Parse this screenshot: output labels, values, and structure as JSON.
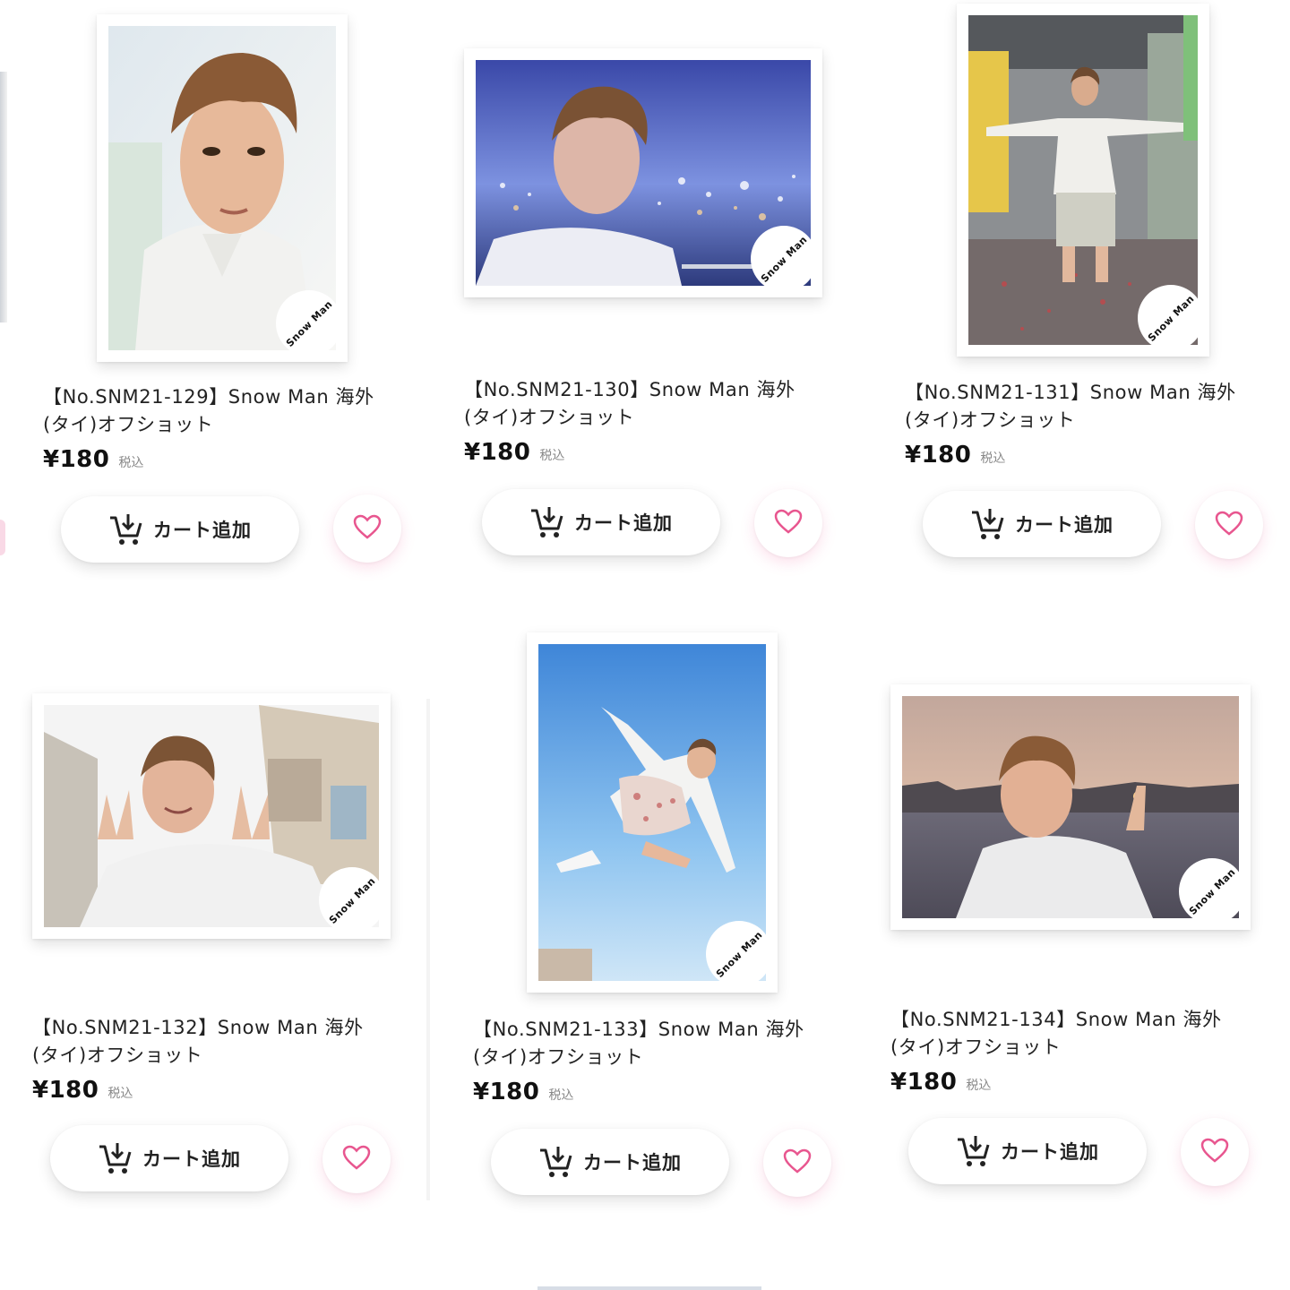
{
  "products": [
    {
      "title": "【No.SNM21-129】Snow Man 海外(タイ)オフショット",
      "price": "¥180",
      "tax_label": "税込",
      "cart_label": "カート追加",
      "photo_stamp": "Snow Man"
    },
    {
      "title": "【No.SNM21-130】Snow Man 海外(タイ)オフショット",
      "price": "¥180",
      "tax_label": "税込",
      "cart_label": "カート追加",
      "photo_stamp": "Snow Man"
    },
    {
      "title": "【No.SNM21-131】Snow Man 海外(タイ)オフショット",
      "price": "¥180",
      "tax_label": "税込",
      "cart_label": "カート追加",
      "photo_stamp": "Snow Man"
    },
    {
      "title": "【No.SNM21-132】Snow Man 海外(タイ)オフショット",
      "price": "¥180",
      "tax_label": "税込",
      "cart_label": "カート追加",
      "photo_stamp": "Snow Man"
    },
    {
      "title": "【No.SNM21-133】Snow Man 海外(タイ)オフショット",
      "price": "¥180",
      "tax_label": "税込",
      "cart_label": "カート追加",
      "photo_stamp": "Snow Man"
    },
    {
      "title": "【No.SNM21-134】Snow Man 海外(タイ)オフショット",
      "price": "¥180",
      "tax_label": "税込",
      "cart_label": "カート追加",
      "photo_stamp": "Snow Man"
    }
  ],
  "icons": {
    "cart": "cart-download-icon",
    "favorite": "heart-outline-icon"
  },
  "colors": {
    "heart": "#e8568f",
    "text": "#222222",
    "tax": "#888888"
  }
}
